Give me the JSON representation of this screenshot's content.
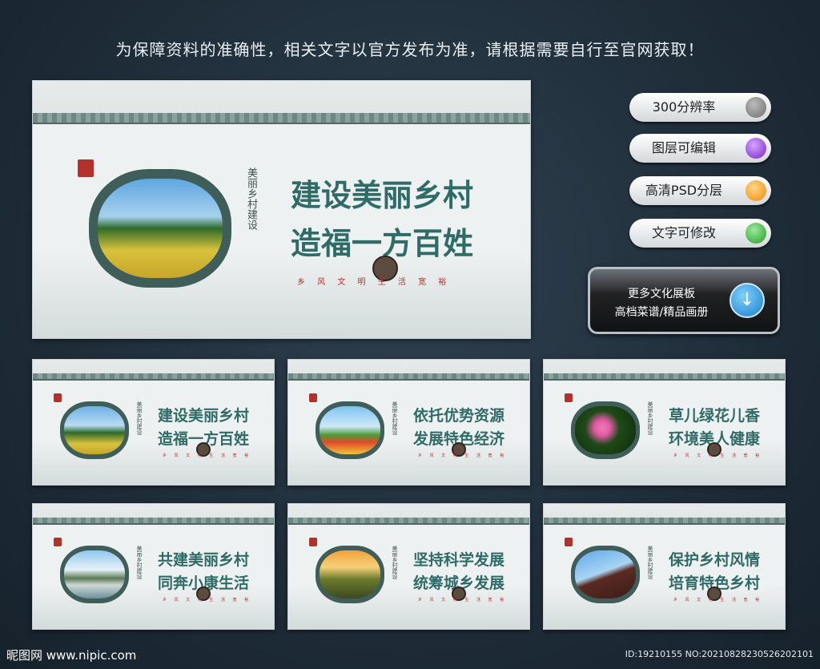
{
  "notice": "为保障资料的准确性，相关文字以官方发布为准，请根据需要自行至官网获取！",
  "main_board": {
    "vertical_title": "美丽乡村建设",
    "slogan_line1": "建设美丽乡村",
    "slogan_line2": "造福一方百姓",
    "motto": "乡 风 文 明   生 活 宽 裕"
  },
  "features": [
    {
      "label": "300分辨率",
      "color": "#6e6e6e"
    },
    {
      "label": "图层可编辑",
      "color": "#7a22c9"
    },
    {
      "label": "高清PSD分层",
      "color": "#f08a00"
    },
    {
      "label": "文字可修改",
      "color": "#23a023"
    }
  ],
  "more_button": {
    "line1": "更多文化展板",
    "line2": "高档菜谱/精品画册",
    "icon": "download-arrow-icon"
  },
  "boards": [
    {
      "line1": "建设美丽乡村",
      "line2": "造福一方百姓",
      "photo": "village"
    },
    {
      "line1": "依托优势资源",
      "line2": "发展特色经济",
      "photo": "tulips"
    },
    {
      "line1": "草儿绿花儿香",
      "line2": "环境美人健康",
      "photo": "pink-flowers"
    },
    {
      "line1": "共建美丽乡村",
      "line2": "同奔小康生活",
      "photo": "riverside-village"
    },
    {
      "line1": "坚持科学发展",
      "line2": "统筹城乡发展",
      "photo": "old-gate"
    },
    {
      "line1": "保护乡村风情",
      "line2": "培育特色乡村",
      "photo": "pagoda-roof"
    }
  ],
  "watermark": {
    "site": "昵图网 www.nipic.com",
    "id": "ID:19210155 NO:20210828230526202101"
  }
}
